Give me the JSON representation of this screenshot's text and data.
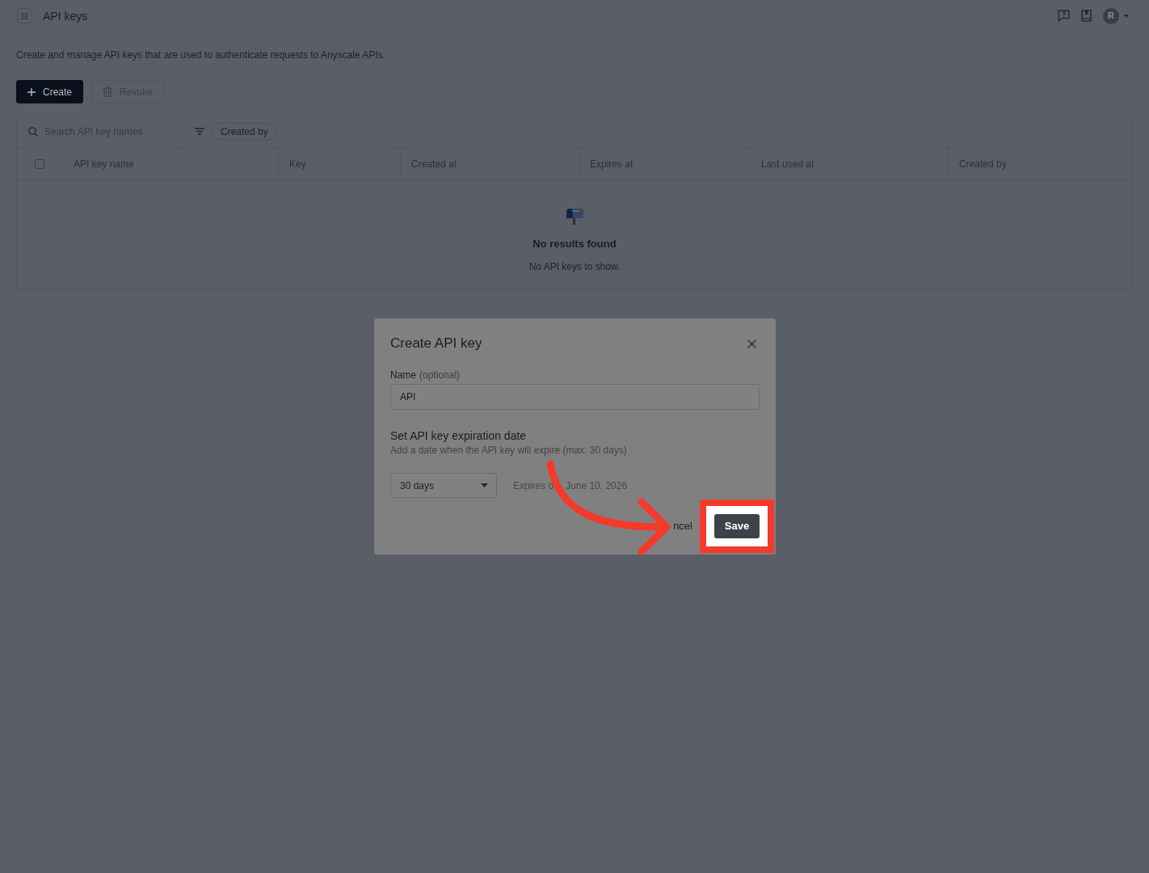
{
  "header": {
    "title": "API keys",
    "avatar": {
      "initial": "R"
    }
  },
  "description": "Create and manage API keys that are used to authenticate requests to Anyscale APIs.",
  "actions": [
    {
      "label": "Create",
      "kind": "create",
      "disabled": false
    },
    {
      "label": "Revoke",
      "kind": "revoke",
      "disabled": true
    }
  ],
  "table": {
    "search": {
      "placeholder": "Search API key names"
    },
    "filters": [
      {
        "label": "Created by"
      }
    ],
    "select_all": {
      "checked": false
    },
    "columns": [
      {
        "label": "API key name"
      },
      {
        "label": "Key"
      },
      {
        "label": "Created at"
      },
      {
        "label": "Expires at"
      },
      {
        "label": "Last used at"
      },
      {
        "label": "Created by"
      }
    ],
    "empty_state": {
      "title": "No results found",
      "message": "No API keys to show."
    }
  },
  "dialog": {
    "title": "Create API key",
    "name_field": {
      "label": "Name",
      "hint": "(optional)",
      "value": "API"
    },
    "expiration": {
      "heading": "Set API key expiration date",
      "description": "Add a date when the API key will expire (max: 30 days)",
      "select": {
        "value": "30 days"
      },
      "expiry_text": [
        "Expires o",
        "June 10, 2026"
      ]
    },
    "buttons": [
      {
        "label": "ncel",
        "kind": "cancel",
        "highlighted": false
      },
      {
        "label": "Save",
        "kind": "save",
        "highlighted": true
      }
    ]
  },
  "annotations": [
    {
      "kind": "curved-arrow"
    }
  ]
}
